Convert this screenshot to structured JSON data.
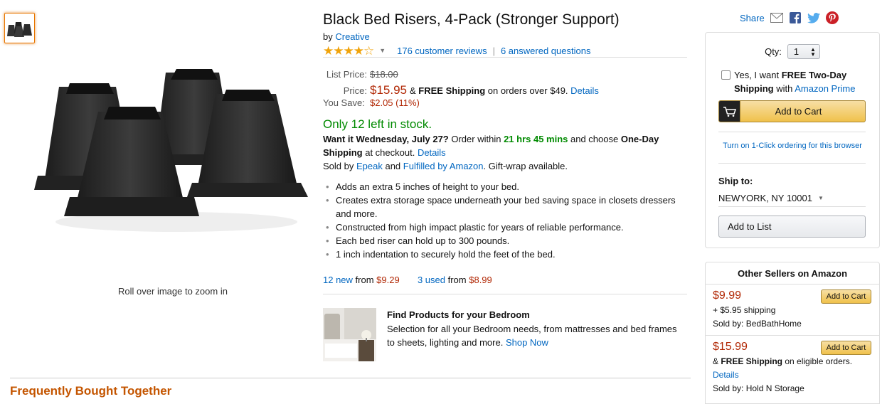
{
  "product": {
    "title": "Black Bed Risers, 4-Pack (Stronger Support)",
    "by_label": "by",
    "brand": "Creative",
    "rating_value": 3.5,
    "rating_stars": "★★★★☆",
    "reviews_link": "176 customer reviews",
    "questions_link": "6 answered questions",
    "zoom_hint": "Roll over image to zoom in"
  },
  "price": {
    "list_label": "List Price:",
    "list_price": "$18.00",
    "price_label": "Price:",
    "price": "$15.95",
    "shipping_prefix": "& ",
    "free_shipping": "FREE Shipping",
    "shipping_suffix": " on orders over $49.",
    "details": "Details",
    "save_label": "You Save:",
    "save_value": "$2.05 (11%)"
  },
  "availability": {
    "stock": "Only 12 left in stock.",
    "want_it": "Want it Wednesday, July 27?",
    "order_within": " Order within ",
    "time_left": "21 hrs 45 mins",
    "choose": " and choose ",
    "one_day": "One-Day Shipping",
    "at_checkout": " at checkout. ",
    "details": "Details",
    "sold_by_label": "Sold by ",
    "seller": "Epeak",
    "and": " and ",
    "fulfilled": "Fulfilled by Amazon",
    "gift_wrap": ". Gift-wrap available."
  },
  "features": [
    "Adds an extra 5 inches of height to your bed.",
    "Creates extra storage space underneath your bed saving space in closets dressers and more.",
    "Constructed from high impact plastic for years of reliable performance.",
    "Each bed riser can hold up to 300 pounds.",
    "1 inch indentation to securely hold the feet of the bed."
  ],
  "offers": {
    "new_link": "12 new",
    "new_from": " from ",
    "new_price": "$9.29",
    "used_link": "3 used",
    "used_from": " from ",
    "used_price": "$8.99"
  },
  "promo": {
    "title": "Find Products for your Bedroom",
    "desc": "Selection for all your Bedroom needs, from mattresses and bed frames to sheets, lighting and more. ",
    "link": "Shop Now"
  },
  "fbt_title": "Frequently Bought Together",
  "share": {
    "label": "Share",
    "icons": [
      "email-icon",
      "facebook-icon",
      "twitter-icon",
      "pinterest-icon"
    ]
  },
  "buybox": {
    "qty_label": "Qty:",
    "qty_value": "1",
    "prime_text_1": "Yes, I want ",
    "prime_bold": "FREE Two-Day Shipping",
    "prime_text_2": " with ",
    "prime_link": "Amazon Prime",
    "add_to_cart": "Add to Cart",
    "one_click": "Turn on 1-Click ordering for this browser",
    "ship_to_label": "Ship to:",
    "ship_to_value": "NEWYORK, NY 10001",
    "add_to_list": "Add to List"
  },
  "other_sellers": {
    "header": "Other Sellers on Amazon",
    "button": "Add to Cart",
    "items": [
      {
        "price": "$9.99",
        "shipping": "+ $5.95 shipping",
        "sold_by_label": "Sold by: ",
        "seller": "BedBathHome"
      },
      {
        "price": "$15.99",
        "shipping_prefix": "& ",
        "shipping_bold": "FREE Shipping",
        "shipping_suffix": " on eligible orders. ",
        "details": "Details",
        "sold_by_label": "Sold by: ",
        "seller": "Hold N Storage"
      }
    ]
  },
  "colors": {
    "link": "#0066c0",
    "price": "#b12704",
    "stock": "#008a00",
    "heading_orange": "#c45500",
    "button_yellow": "#f0c14b",
    "star": "#f0a30a"
  }
}
